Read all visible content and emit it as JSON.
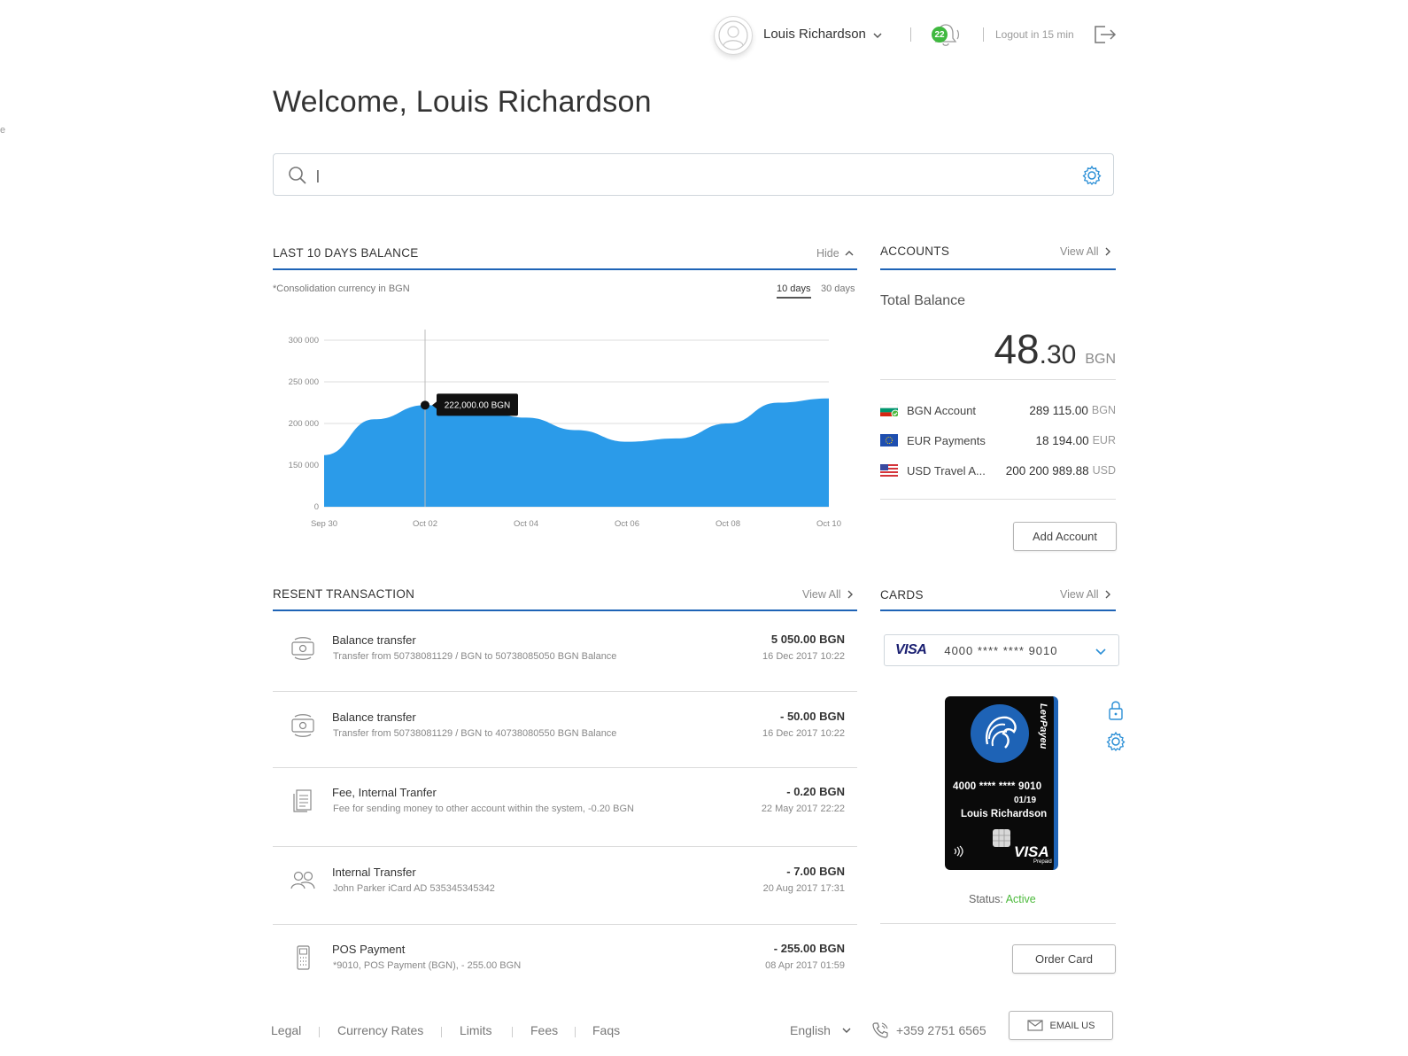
{
  "header": {
    "user_name": "Louis Richardson",
    "notifications_count": "22",
    "logout_text": "Logout in 15 min"
  },
  "welcome": "Welcome, Louis Richardson",
  "search": {
    "value": "|",
    "placeholder": ""
  },
  "balance_section": {
    "title": "LAST 10 DAYS BALANCE",
    "hide_label": "Hide",
    "note": "*Consolidation currency in BGN",
    "tabs": [
      "10 days",
      "30 days"
    ],
    "active_tab": "10 days",
    "tooltip": "222,000.00  BGN"
  },
  "chart_data": {
    "type": "area",
    "x": [
      "Sep 30",
      "Oct 01",
      "Oct 02",
      "Oct 03",
      "Oct 04",
      "Oct 05",
      "Oct 06",
      "Oct 07",
      "Oct 08",
      "Oct 09",
      "Oct 10"
    ],
    "x_tick_labels": [
      "Sep 30",
      "Oct 02",
      "Oct 04",
      "Oct 06",
      "Oct 08",
      "Oct 10"
    ],
    "values": [
      162000,
      205000,
      222000,
      218000,
      207000,
      192000,
      178000,
      182000,
      200000,
      225000,
      230000
    ],
    "y_ticks": [
      0,
      150000,
      250000,
      200000,
      300000
    ],
    "y_tick_labels": [
      "0",
      "150 000",
      "200 000",
      "250 000",
      "300 000"
    ],
    "ylim": [
      0,
      300000
    ],
    "y_axis_break": [
      0,
      150000
    ],
    "highlight_index": 2,
    "color": "#2b9be9",
    "grid": true
  },
  "accounts": {
    "title": "ACCOUNTS",
    "view_all": "View All",
    "total_label": "Total Balance",
    "total_int": "48",
    "total_dec": ".30",
    "total_currency": "BGN",
    "items": [
      {
        "name": "BGN Account",
        "amount": "289 115.00",
        "currency": "BGN",
        "flag": "bg"
      },
      {
        "name": "EUR Payments",
        "amount": "18 194.00",
        "currency": "EUR",
        "flag": "eu"
      },
      {
        "name": "USD Travel A...",
        "amount": "200 200 989.88",
        "currency": "USD",
        "flag": "us"
      }
    ],
    "add_button": "Add Account"
  },
  "transactions": {
    "title": "RESENT TRANSACTION",
    "view_all": "View All",
    "items": [
      {
        "icon": "money-transfer-icon",
        "title": "Balance transfer",
        "desc": "Transfer from 50738081129 / BGN to 50738085050 BGN Balance",
        "amount": "5 050.00 BGN",
        "date": "16 Dec 2017   10:22"
      },
      {
        "icon": "money-transfer-icon",
        "title": "Balance transfer",
        "desc": "Transfer from 50738081129 / BGN to 40738080550 BGN Balance",
        "amount": "- 50.00 BGN",
        "date": "16 Dec 2017   10:22"
      },
      {
        "icon": "document-icon",
        "title": "Fee, Internal Tranfer",
        "desc": "Fee for sending money to other account within the system, -0.20 BGN",
        "amount": "- 0.20 BGN",
        "date": "22 May 2017   22:22"
      },
      {
        "icon": "users-icon",
        "title": "Internal Transfer",
        "desc": "John Parker  iCard AD 535345345342",
        "amount": "- 7.00 BGN",
        "date": "20 Aug 2017   17:31"
      },
      {
        "icon": "pos-terminal-icon",
        "title": "POS Payment",
        "desc": "*9010, POS Payment (BGN), - 255.00 BGN",
        "amount": "- 255.00 BGN",
        "date": "08 Apr 2017   01:59"
      }
    ]
  },
  "cards": {
    "title": "CARDS",
    "view_all": "View All",
    "selected_brand": "VISA",
    "selected_number": "4000  ****  ****  9010",
    "card_number": "4000 **** **** 9010",
    "card_expiry": "01/19",
    "card_holder": "Louis Richardson",
    "card_issuer": "LevPayeu",
    "card_brand": "VISA",
    "card_brand_sub": "Prepaid",
    "status_label": "Status:",
    "status_value": "Active",
    "order_button": "Order Card"
  },
  "footer": {
    "links": [
      "Legal",
      "Currency Rates",
      "Limits",
      "Fees",
      "Faqs"
    ],
    "language": "English",
    "phone": "+359 2751 6565",
    "email_button": "EMAIL US"
  },
  "colors": {
    "accent": "#1e63b6",
    "chart": "#2b9be9",
    "active": "#4cba3c",
    "badge": "#3fb93f"
  }
}
